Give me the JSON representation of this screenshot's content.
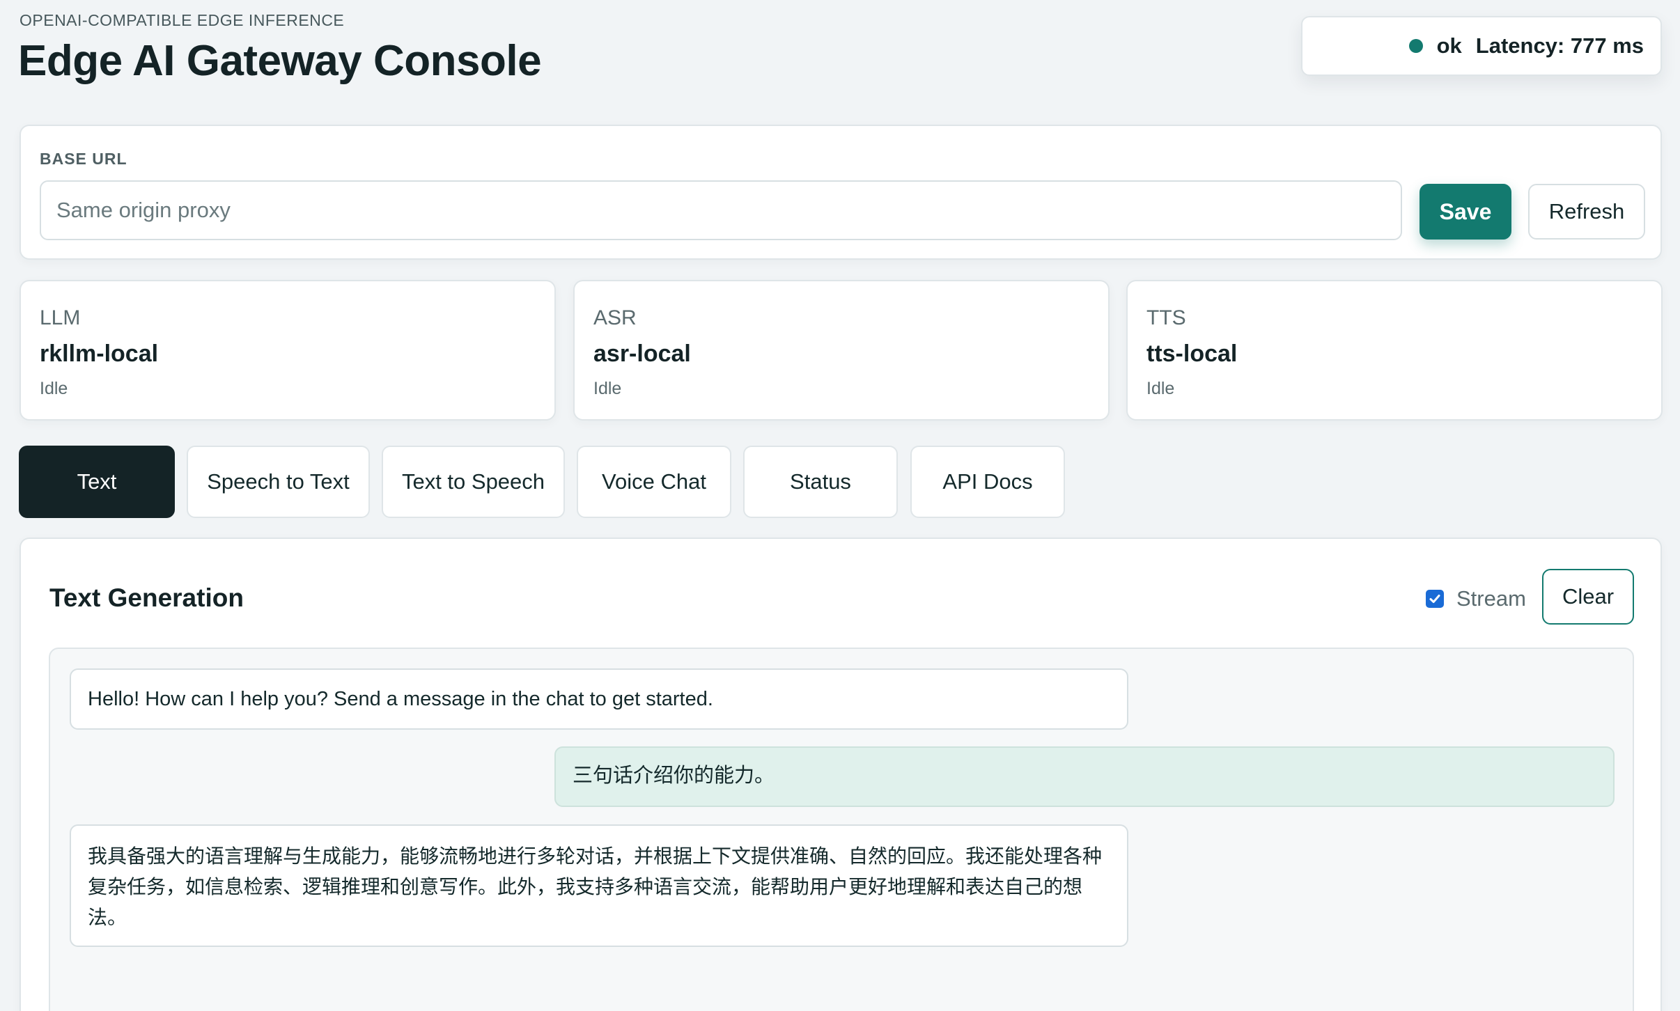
{
  "header": {
    "eyebrow": "OPENAI-COMPATIBLE EDGE INFERENCE",
    "title": "Edge AI Gateway Console"
  },
  "status": {
    "state": "ok",
    "latency_text": "Latency: 777 ms",
    "dot_color": "#137a6f"
  },
  "base_url": {
    "label": "BASE URL",
    "value": "",
    "placeholder": "Same origin proxy",
    "save_label": "Save",
    "refresh_label": "Refresh"
  },
  "models": [
    {
      "kind": "LLM",
      "name": "rkllm-local",
      "state": "Idle"
    },
    {
      "kind": "ASR",
      "name": "asr-local",
      "state": "Idle"
    },
    {
      "kind": "TTS",
      "name": "tts-local",
      "state": "Idle"
    }
  ],
  "tabs": [
    {
      "label": "Text",
      "active": true
    },
    {
      "label": "Speech to Text",
      "active": false
    },
    {
      "label": "Text to Speech",
      "active": false
    },
    {
      "label": "Voice Chat",
      "active": false
    },
    {
      "label": "Status",
      "active": false
    },
    {
      "label": "API Docs",
      "active": false
    }
  ],
  "panel": {
    "title": "Text Generation",
    "stream_label": "Stream",
    "stream_checked": true,
    "clear_label": "Clear"
  },
  "messages": [
    {
      "role": "assistant",
      "text": "Hello! How can I help you? Send a message in the chat to get started."
    },
    {
      "role": "user",
      "text": "三句话介绍你的能力。"
    },
    {
      "role": "assistant",
      "text": "我具备强大的语言理解与生成能力，能够流畅地进行多轮对话，并根据上下文提供准确、自然的回应。我还能处理各种复杂任务，如信息检索、逻辑推理和创意写作。此外，我支持多种语言交流，能帮助用户更好地理解和表达自己的想法。"
    }
  ],
  "colors": {
    "accent": "#137a6f",
    "dark": "#142326",
    "user_bubble": "#e0f1ec",
    "checkbox": "#1a6bd6"
  }
}
